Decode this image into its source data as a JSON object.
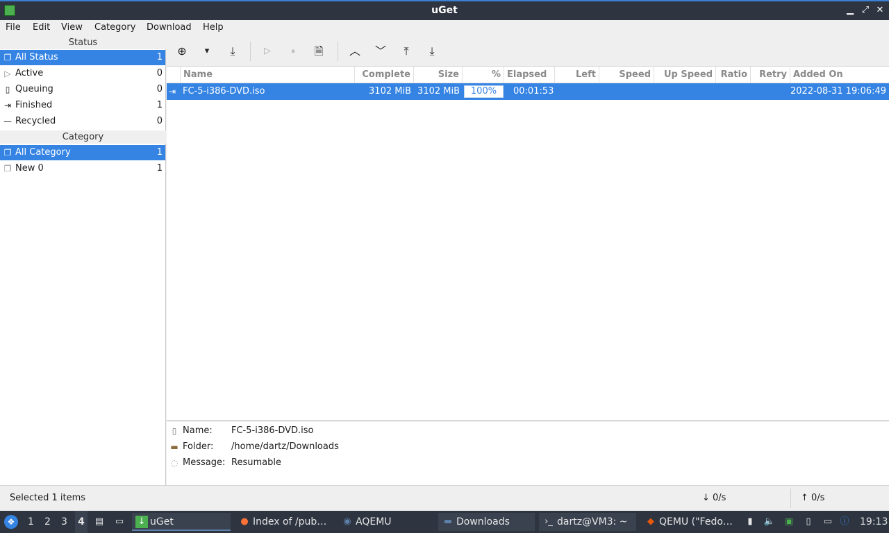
{
  "window": {
    "title": "uGet",
    "minimize": "▁",
    "maximize": "⤢",
    "close": "✕"
  },
  "menu": [
    "File",
    "Edit",
    "View",
    "Category",
    "Download",
    "Help"
  ],
  "sidebar": {
    "status_header": "Status",
    "status_items": [
      {
        "label": "All Status",
        "count": "1",
        "icon": "all-status-icon",
        "glyph": "❐",
        "selected": true
      },
      {
        "label": "Active",
        "count": "0",
        "icon": "play-icon",
        "glyph": "▷"
      },
      {
        "label": "Queuing",
        "count": "0",
        "icon": "document-icon",
        "glyph": "▯"
      },
      {
        "label": "Finished",
        "count": "1",
        "icon": "finished-icon",
        "glyph": "⇥"
      },
      {
        "label": "Recycled",
        "count": "0",
        "icon": "recycled-icon",
        "glyph": "—"
      }
    ],
    "category_header": "Category",
    "category_items": [
      {
        "label": "All Category",
        "count": "1",
        "icon": "all-category-icon",
        "glyph": "❐",
        "selected": true
      },
      {
        "label": "New 0",
        "count": "1",
        "icon": "category-icon",
        "glyph": "❐"
      }
    ]
  },
  "toolbar": {
    "buttons": [
      {
        "name": "new-download-button",
        "glyph": "⊕"
      },
      {
        "name": "new-dropdown-button",
        "glyph": "▾"
      },
      {
        "name": "save-button",
        "glyph": "⤓"
      },
      {
        "name": "start-button",
        "glyph": "▷",
        "disabled": true
      },
      {
        "name": "pause-button",
        "glyph": "⏸",
        "disabled": true
      },
      {
        "name": "properties-button",
        "glyph": "🗎"
      },
      {
        "name": "move-up-button",
        "glyph": "︿"
      },
      {
        "name": "move-down-button",
        "glyph": "﹀"
      },
      {
        "name": "move-top-button",
        "glyph": "⤒"
      },
      {
        "name": "move-bottom-button",
        "glyph": "⤓"
      }
    ]
  },
  "table": {
    "columns": [
      "Name",
      "Complete",
      "Size",
      "%",
      "Elapsed",
      "Left",
      "Speed",
      "Up Speed",
      "Ratio",
      "Retry",
      "Added On"
    ],
    "rows": [
      {
        "name": "FC-5-i386-DVD.iso",
        "complete": "3102 MiB",
        "size": "3102 MiB",
        "percent": "100%",
        "progress": 1.0,
        "elapsed": "00:01:53",
        "left": "",
        "speed": "",
        "up_speed": "",
        "ratio": "",
        "retry": "",
        "added_on": "2022-08-31 19:06:49"
      }
    ]
  },
  "details": {
    "name_label": "Name:",
    "name_value": "FC-5-i386-DVD.iso",
    "folder_label": "Folder:",
    "folder_value": "/home/dartz/Downloads",
    "message_label": "Message:",
    "message_value": "Resumable"
  },
  "statusbar": {
    "selected": "Selected 1 items",
    "down_speed": "↓  0/s",
    "up_speed": "↑  0/s"
  },
  "taskbar": {
    "workspaces": [
      "1",
      "2",
      "3",
      "4"
    ],
    "active_workspace": "4",
    "tasks": [
      {
        "label": "uGet",
        "icon": "uget-icon",
        "active": true
      },
      {
        "label": "Index of /pub…",
        "icon": "firefox-icon"
      },
      {
        "label": "AQEMU",
        "icon": "aqemu-icon"
      },
      {
        "label": "Downloads",
        "icon": "folder-icon"
      },
      {
        "label": "dartz@VM3: ~",
        "icon": "terminal-icon"
      },
      {
        "label": "QEMU (\"Fedo…",
        "icon": "qemu-icon"
      }
    ],
    "clock": "19:13"
  },
  "colors": {
    "accent": "#3584e4",
    "titlebar": "#2e3440",
    "taskbar": "#2e3440"
  }
}
